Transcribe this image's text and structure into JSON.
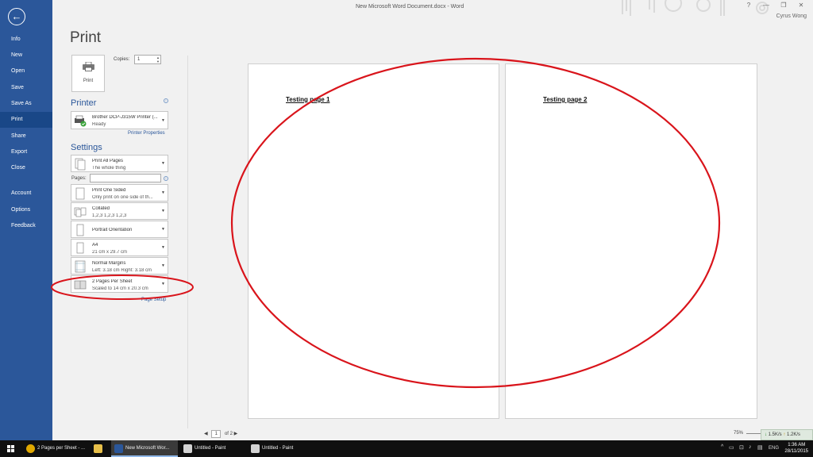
{
  "window": {
    "title": "New Microsoft Word Document.docx - Word",
    "user": "Cyrus Wong",
    "controls": [
      "?",
      "—",
      "❐",
      "✕"
    ]
  },
  "nav": {
    "items": [
      {
        "label": "Info",
        "active": false
      },
      {
        "label": "New",
        "active": false
      },
      {
        "label": "Open",
        "active": false
      },
      {
        "label": "Save",
        "active": false
      },
      {
        "label": "Save As",
        "active": false
      },
      {
        "label": "Print",
        "active": true
      },
      {
        "label": "Share",
        "active": false
      },
      {
        "label": "Export",
        "active": false
      },
      {
        "label": "Close",
        "active": false
      },
      {
        "label": "Account",
        "active": false
      },
      {
        "label": "Options",
        "active": false
      },
      {
        "label": "Feedback",
        "active": false
      }
    ]
  },
  "print": {
    "heading": "Print",
    "button_label": "Print",
    "copies_label": "Copies:",
    "copies_value": "1"
  },
  "printer": {
    "title": "Printer",
    "name": "Brother DCP-J315W Printer (...",
    "status": "Ready",
    "properties_link": "Printer Properties"
  },
  "settings": {
    "title": "Settings",
    "pages_label": "Pages:",
    "page_setup_link": "Page Setup",
    "options": [
      {
        "line1": "Print All Pages",
        "line2": "The whole thing"
      },
      {
        "line1": "Print One Sided",
        "line2": "Only print on one side of th..."
      },
      {
        "line1": "Collated",
        "line2": "1,2,3    1,2,3    1,2,3"
      },
      {
        "line1": "Portrait Orientation",
        "line2": ""
      },
      {
        "line1": "A4",
        "line2": "21 cm x 29.7 cm"
      },
      {
        "line1": "Normal Margins",
        "line2": "Left: 3.18 cm    Right: 3.18 cm"
      },
      {
        "line1": "2 Pages Per Sheet",
        "line2": "Scaled to 14 cm x 20.3 cm"
      }
    ]
  },
  "preview": {
    "pages": [
      {
        "text": "Testing page 1"
      },
      {
        "text": "Testing page 2"
      }
    ],
    "current_page": "1",
    "of_text": "of 2",
    "zoom": "75%"
  },
  "network": {
    "down": "1.5K/s",
    "up": "1.2K/s"
  },
  "taskbar": {
    "items": [
      {
        "label": "2 Pages per Sheet - ...",
        "icon": "chrome-icon",
        "color": "#e0a800",
        "active": false
      },
      {
        "label": "",
        "icon": "file-explorer-icon",
        "color": "#e8c04a",
        "active": false
      },
      {
        "label": "New Microsoft Wor...",
        "icon": "word-icon",
        "color": "#2b579a",
        "active": true
      },
      {
        "label": "Untitled - Paint",
        "icon": "paint-icon",
        "color": "#d4d4d4",
        "active": false
      },
      {
        "label": "Untitled - Paint",
        "icon": "paint-icon",
        "color": "#d4d4d4",
        "active": false
      }
    ],
    "language": "ENG",
    "time": "1:36 AM",
    "date": "28/11/2015"
  },
  "colors": {
    "word_blue": "#2b579a",
    "annotation_red": "#d9141b"
  }
}
